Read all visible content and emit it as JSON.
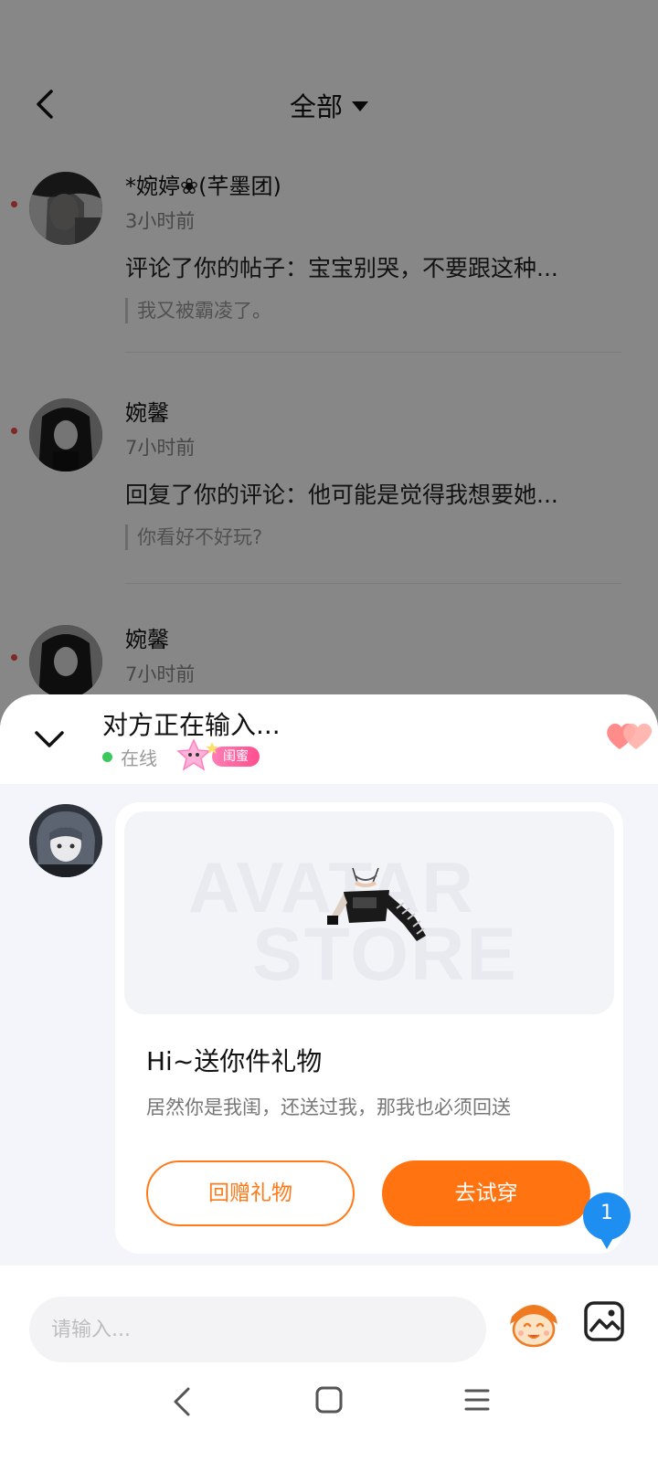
{
  "header": {
    "filter_label": "全部"
  },
  "notifications": [
    {
      "name": "*婉婷❀(芊墨团)",
      "time": "3小时前",
      "action": "评论了你的帖子：宝宝别哭，不要跟这种...",
      "quote": "我又被霸凌了。"
    },
    {
      "name": "婉馨",
      "time": "7小时前",
      "action": "回复了你的评论：他可能是觉得我想要她...",
      "quote": "你看好不好玩?"
    },
    {
      "name": "婉馨",
      "time": "7小时前"
    }
  ],
  "chat": {
    "typing_status": "对方正在输入...",
    "online_text": "在线",
    "relation_badge": "闺蜜",
    "card": {
      "banner_word_1": "AVATAR",
      "banner_word_2": "STORE",
      "title": "Hi~送你件礼物",
      "description": "居然你是我闺，还送过我，那我也必须回送",
      "button_return_gift": "回赠礼物",
      "button_try_on": "去试穿"
    },
    "unread_count": "1",
    "input_placeholder": "请输入..."
  },
  "colors": {
    "accent_orange": "#ff7410",
    "online_green": "#3cc85a",
    "unread_blue": "#1e8ef0",
    "badge_pink": "#ff5f9c"
  },
  "icons": {
    "back": "chevron-left-icon",
    "filter_caret": "caret-down-icon",
    "collapse": "chevron-down-icon",
    "hearts": "hearts-icon",
    "emoji": "emoji-face-icon",
    "image": "image-icon",
    "nav_back": "nav-back-icon",
    "nav_home": "nav-home-icon",
    "nav_menu": "nav-menu-icon"
  }
}
